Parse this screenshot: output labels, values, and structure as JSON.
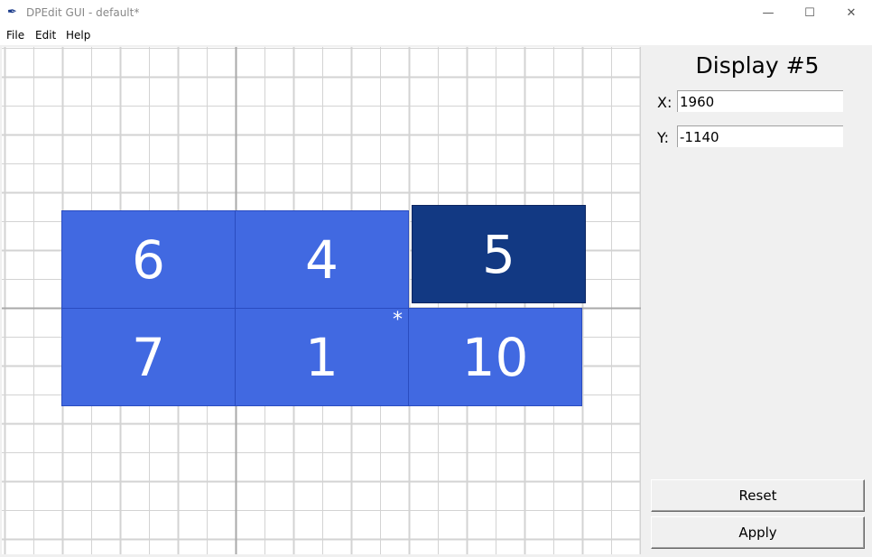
{
  "window": {
    "title": "DPEdit GUI - default*",
    "controls": {
      "minimize": "—",
      "maximize": "☐",
      "close": "✕"
    }
  },
  "menu": [
    "File",
    "Edit",
    "Help"
  ],
  "canvas": {
    "displays": [
      {
        "id": "6",
        "selected": false,
        "primary": false
      },
      {
        "id": "4",
        "selected": false,
        "primary": false
      },
      {
        "id": "5",
        "selected": true,
        "primary": false
      },
      {
        "id": "7",
        "selected": false,
        "primary": false
      },
      {
        "id": "1",
        "selected": false,
        "primary": true
      },
      {
        "id": "10",
        "selected": false,
        "primary": false
      }
    ],
    "primary_marker": "*",
    "colors": {
      "display": "#4169e1",
      "selected": "#123983",
      "grid": "#d3d3d3",
      "axis": "#a9a9a9"
    }
  },
  "panel": {
    "title": "Display #5",
    "x_label": "X:",
    "x_value": "1960",
    "y_label": "Y:",
    "y_value": "-1140",
    "reset_label": "Reset",
    "apply_label": "Apply"
  }
}
